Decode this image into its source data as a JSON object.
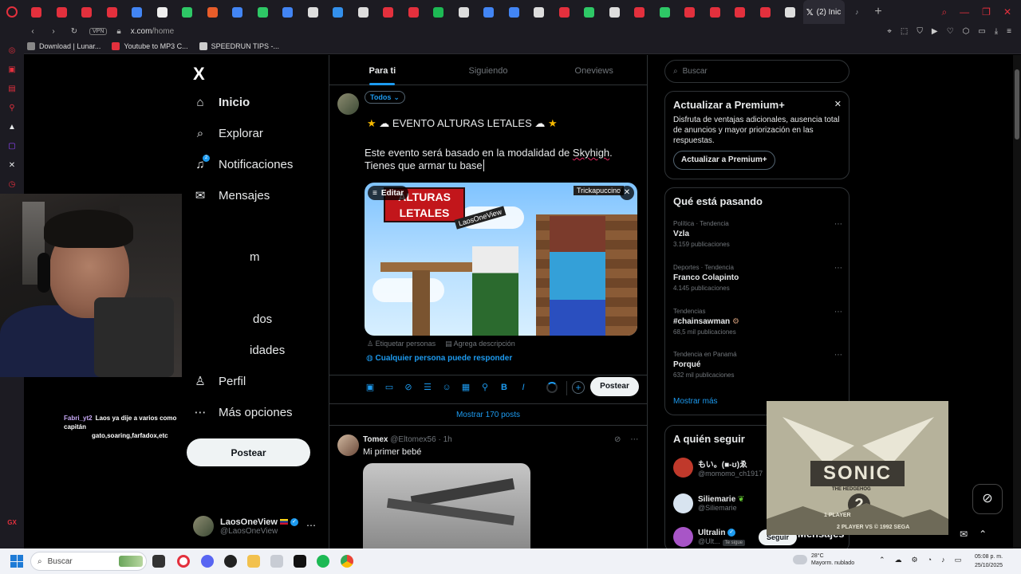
{
  "browser": {
    "active_tab_title": "(2) Inic",
    "url_host": "x.com",
    "url_path": "/home",
    "vpn_label": "VPN",
    "bookmarks": [
      "Download | Lunar...",
      "Youtube to MP3 C...",
      "SPEEDRUN TIPS -..."
    ],
    "tab_favicon_colors": [
      "#e3303d",
      "#e3303d",
      "#e3303d",
      "#e3303d",
      "#4285f4",
      "#eeeeee",
      "#2ec866",
      "#e85d2a",
      "#4285f4",
      "#2ec866",
      "#4285f4",
      "#dddddd",
      "#3390ec",
      "#dddddd",
      "#e3303d",
      "#e3303d",
      "#1db954",
      "#dddddd",
      "#4285f4",
      "#4285f4",
      "#dddddd",
      "#e3303d",
      "#2ec866",
      "#dddddd",
      "#e3303d",
      "#2ec866",
      "#e3303d",
      "#e3303d",
      "#e3303d",
      "#e3303d",
      "#dddddd"
    ]
  },
  "nav": {
    "logo": "X",
    "items": [
      {
        "label": "Inicio",
        "icon": "home-icon"
      },
      {
        "label": "Explorar",
        "icon": "search-icon"
      },
      {
        "label": "Notificaciones",
        "icon": "bell-icon",
        "badge": "2"
      },
      {
        "label": "Mensajes",
        "icon": "mail-icon"
      },
      {
        "label": "m",
        "icon": "premium-icon"
      },
      {
        "label": "dos",
        "icon": "bookmark-icon"
      },
      {
        "label": "idades",
        "icon": "communities-icon"
      },
      {
        "label": "Perfil",
        "icon": "person-icon"
      },
      {
        "label": "Más opciones",
        "icon": "more-icon"
      }
    ],
    "post_button": "Postear",
    "account": {
      "name": "LaosOneView",
      "handle": "@LaosOneView"
    }
  },
  "chat": {
    "user": "Fabri_yt2",
    "message": "Laos ya dije a varios como capitán",
    "message2": "gato,soaring,farfadox,etc"
  },
  "main": {
    "tabs": [
      "Para ti",
      "Siguiendo",
      "Oneviews"
    ],
    "audience": "Todos",
    "compose_title": "EVENTO ALTURAS LETALES",
    "compose_line1_a": "Este evento será basado en la modalidad de ",
    "compose_line1_b": "Skyhigh",
    "compose_line1_c": ".",
    "compose_line2": "Tienes que armar tu base",
    "media_edit": "Editar",
    "media_logo": "ALTURAS LETALES",
    "media_tag1": "LaosOneView",
    "media_tag2": "Trickapuccino",
    "tag_people": "Etiquetar personas",
    "add_description": "Agrega descripción",
    "reply_setting": "Cualquier persona puede responder",
    "post_button": "Postear",
    "show_posts": "Mostrar 170 posts",
    "tweet": {
      "name": "Tomex",
      "handle": "@Eltomex56",
      "time": "1h",
      "text": "Mi primer bebé"
    }
  },
  "right": {
    "search_placeholder": "Buscar",
    "premium": {
      "title": "Actualizar a Premium+",
      "text": "Disfruta de ventajas adicionales, ausencia total de anuncios y mayor priorización en las respuestas.",
      "button": "Actualizar a Premium+"
    },
    "trends_title": "Qué está pasando",
    "trends": [
      {
        "category": "Política · Tendencia",
        "name": "Vzla",
        "count": "3.159 publicaciones"
      },
      {
        "category": "Deportes · Tendencia",
        "name": "Franco Colapinto",
        "count": "4.145 publicaciones"
      },
      {
        "category": "Tendencias",
        "name": "#chainsawman",
        "count": "68,5 mil publicaciones"
      },
      {
        "category": "Tendencia en Panamá",
        "name": "Porqué",
        "count": "632 mil publicaciones"
      }
    ],
    "show_more": "Mostrar más",
    "follow_title": "A quién seguir",
    "follow": [
      {
        "name": "もい。(■-ʊ)ゑ",
        "handle": "@momomo_ch1917"
      },
      {
        "name": "Siliemarie",
        "handle": "@Siliemarie"
      },
      {
        "name": "Ultralin",
        "handle": "@Ult...",
        "follows_you": "Te sigue"
      }
    ],
    "follow_button": "Seguir",
    "messages": "Mensajes"
  },
  "game": {
    "title": "SONIC",
    "subtitle": "THE HEDGEHOG",
    "number": "2",
    "option1": "1 PLAYER",
    "option2": "2 PLAYER VS © 1992 SEGA"
  },
  "taskbar": {
    "search_placeholder": "Buscar",
    "weather_temp": "28°C",
    "weather_desc": "Mayorm. nublado",
    "time": "05:08 p. m.",
    "date": "25/10/2025"
  }
}
